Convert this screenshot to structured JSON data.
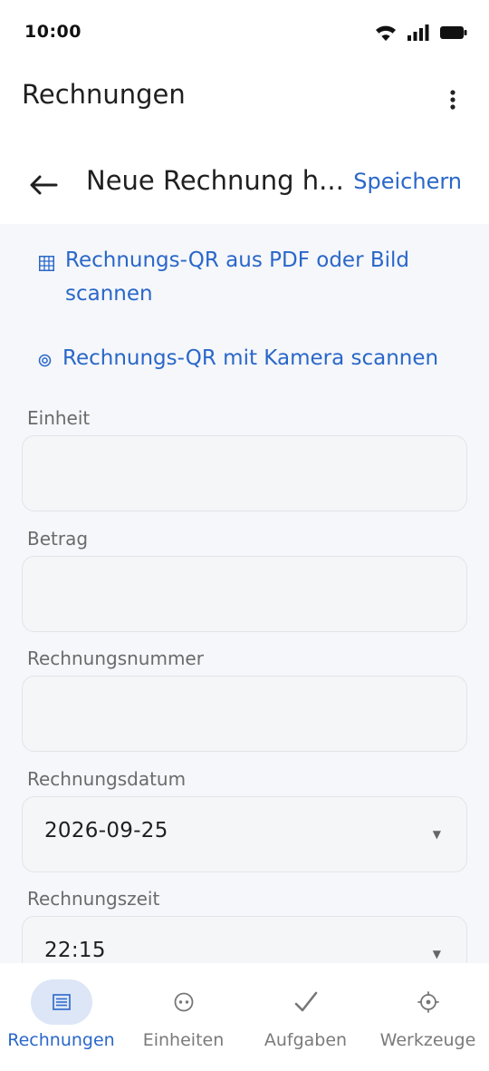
{
  "status_bar": {
    "time": "10:00"
  },
  "app_bar": {
    "title": "Rechnungen"
  },
  "sub_header": {
    "title": "Neue Rechnung h...",
    "save_label": "Speichern"
  },
  "scan_actions": {
    "pdf_label": "Rechnungs-QR aus PDF oder Bild scannen",
    "camera_label": "Rechnungs-QR mit Kamera scannen"
  },
  "form": {
    "einheit": {
      "label": "Einheit",
      "value": ""
    },
    "betrag": {
      "label": "Betrag",
      "value": ""
    },
    "rechnungsnummer": {
      "label": "Rechnungsnummer",
      "value": ""
    },
    "rechnungsdatum": {
      "label": "Rechnungsdatum",
      "value": "2026-09-25"
    },
    "rechnungszeit": {
      "label": "Rechnungszeit",
      "value": "22:15"
    }
  },
  "bottom_nav": {
    "items": [
      {
        "label": "Rechnungen",
        "icon": "invoice-list-icon",
        "active": true
      },
      {
        "label": "Einheiten",
        "icon": "units-icon",
        "active": false
      },
      {
        "label": "Aufgaben",
        "icon": "checkmark-icon",
        "active": false
      },
      {
        "label": "Werkzeuge",
        "icon": "tools-gear-icon",
        "active": false
      }
    ]
  },
  "colors": {
    "accent": "#2a67c9",
    "content_background": "#f5f7fa",
    "active_nav_pill": "#dce6f7"
  }
}
